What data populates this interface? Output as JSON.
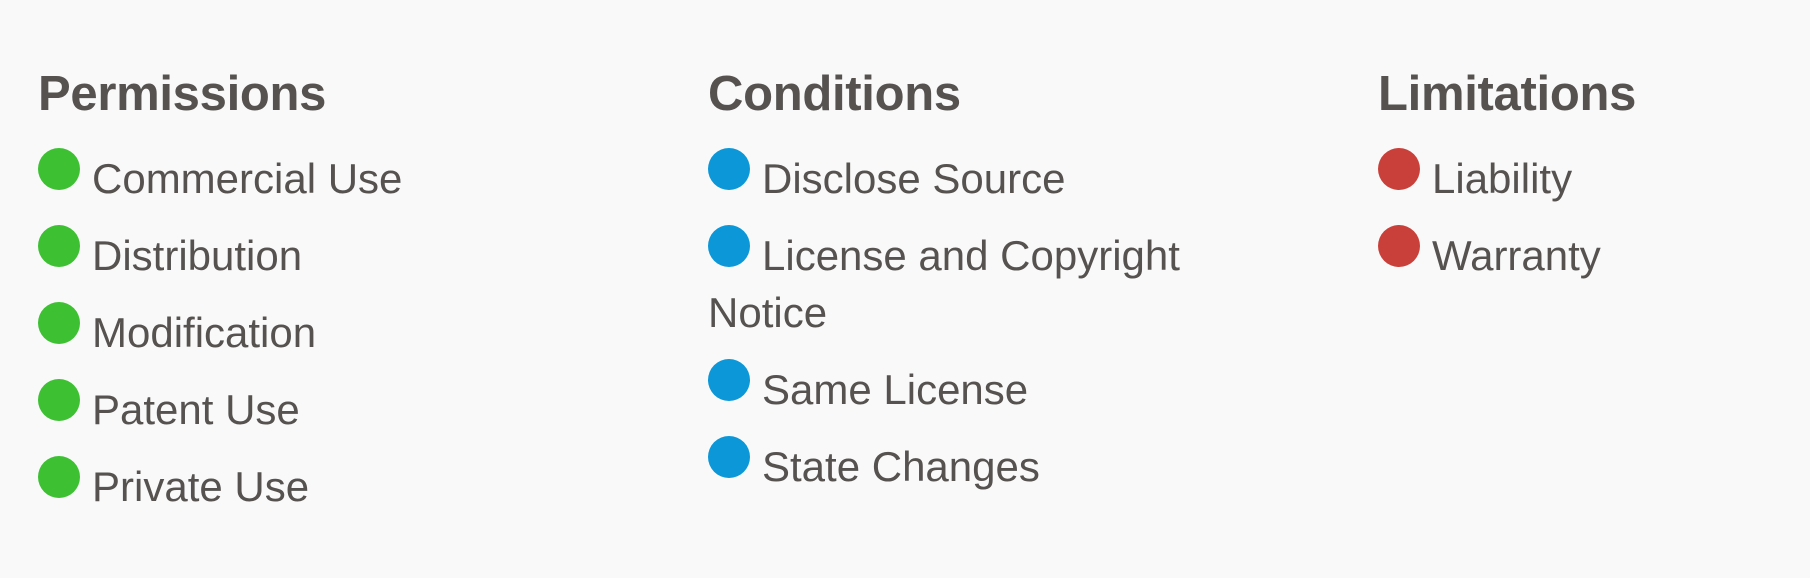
{
  "colors": {
    "permission": "#3dc133",
    "condition": "#0b97d8",
    "limitation": "#c9403a",
    "text": "#555250",
    "background": "#f9f9f9"
  },
  "permissions": {
    "heading": "Permissions",
    "items": [
      {
        "label": "Commercial Use",
        "icon": "green-dot-icon"
      },
      {
        "label": "Distribution",
        "icon": "green-dot-icon"
      },
      {
        "label": "Modification",
        "icon": "green-dot-icon"
      },
      {
        "label": "Patent Use",
        "icon": "green-dot-icon"
      },
      {
        "label": "Private Use",
        "icon": "green-dot-icon"
      }
    ]
  },
  "conditions": {
    "heading": "Conditions",
    "items": [
      {
        "label": "Disclose Source",
        "icon": "blue-dot-icon"
      },
      {
        "label": "License and Copyright Notice",
        "icon": "blue-dot-icon"
      },
      {
        "label": "Same License",
        "icon": "blue-dot-icon"
      },
      {
        "label": "State Changes",
        "icon": "blue-dot-icon"
      }
    ]
  },
  "limitations": {
    "heading": "Limitations",
    "items": [
      {
        "label": "Liability",
        "icon": "red-dot-icon"
      },
      {
        "label": "Warranty",
        "icon": "red-dot-icon"
      }
    ]
  }
}
